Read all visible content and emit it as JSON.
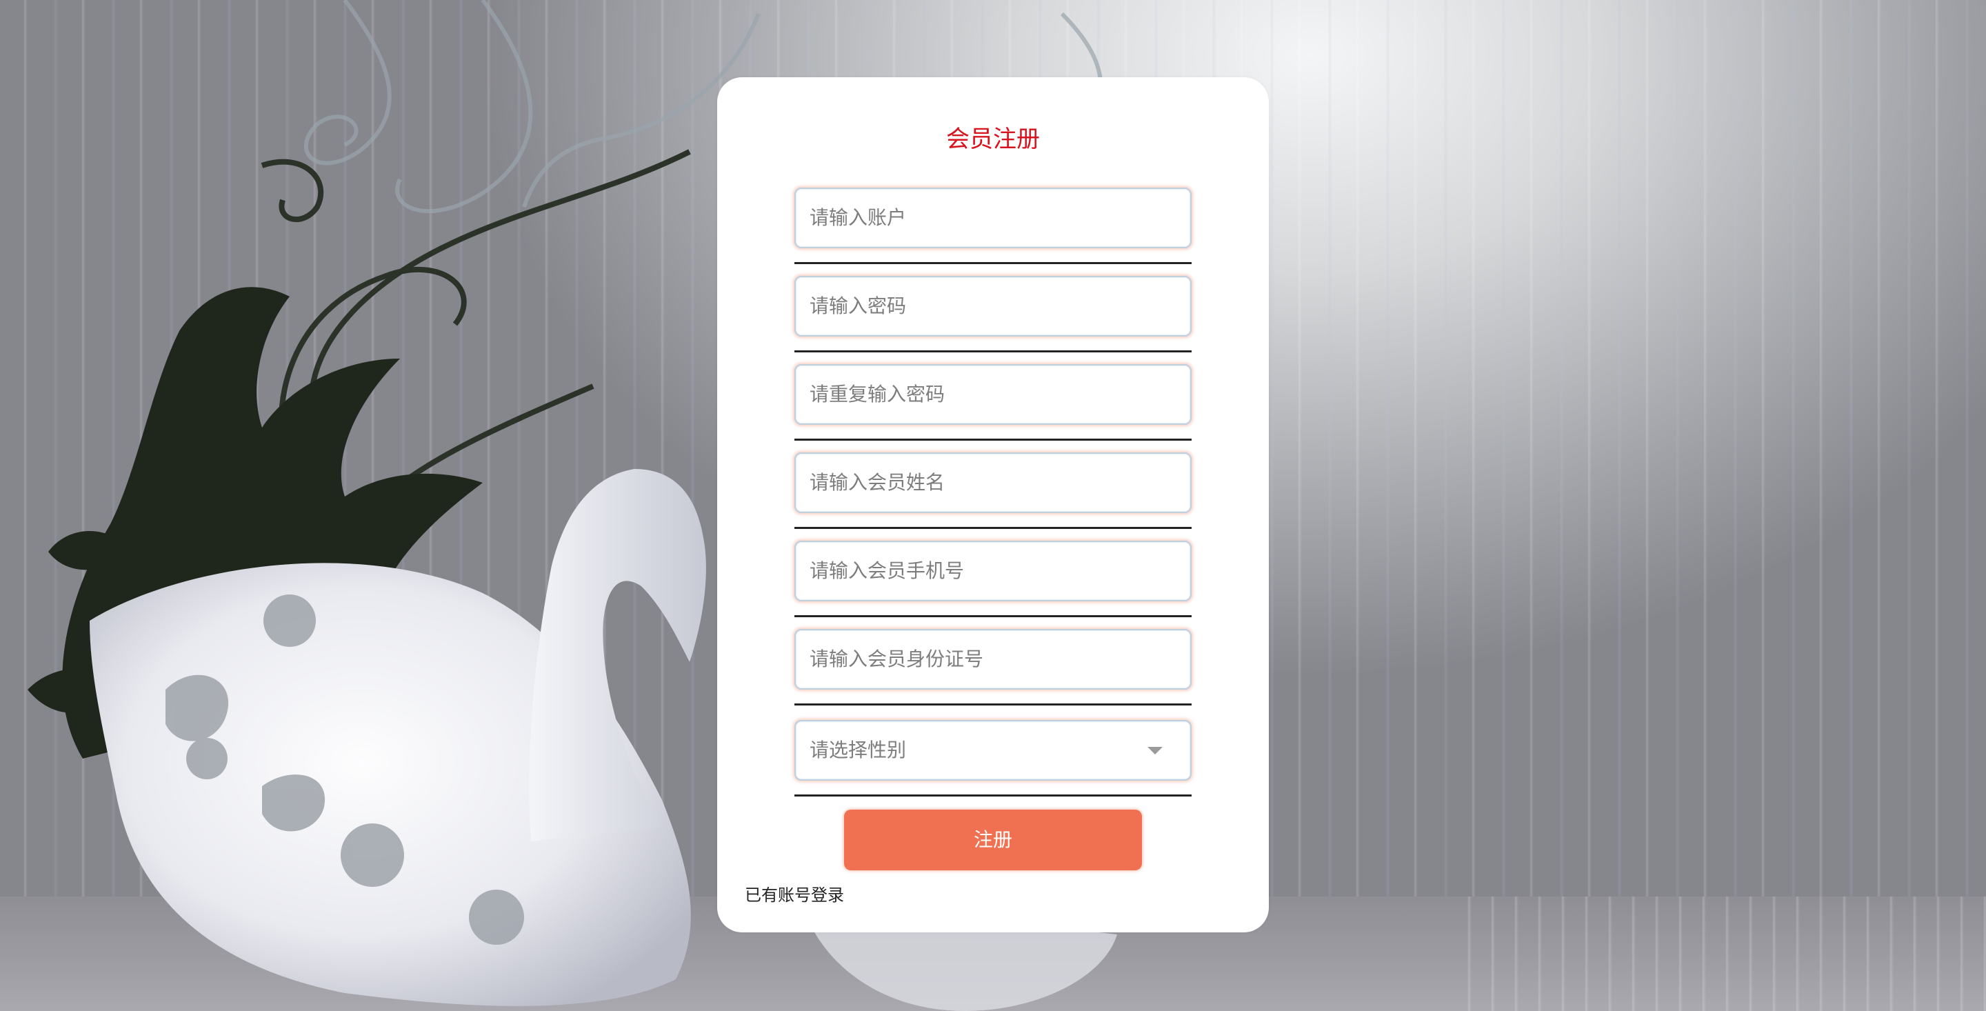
{
  "form": {
    "title": "会员注册",
    "fields": [
      {
        "placeholder": "请输入账户"
      },
      {
        "placeholder": "请输入密码"
      },
      {
        "placeholder": "请重复输入密码"
      },
      {
        "placeholder": "请输入会员姓名"
      },
      {
        "placeholder": "请输入会员手机号"
      },
      {
        "placeholder": "请输入会员身份证号"
      }
    ],
    "gender_select": {
      "placeholder": "请选择性别"
    },
    "submit_label": "注册",
    "login_link": "已有账号登录"
  },
  "colors": {
    "title": "#d9131d",
    "button": "#f07152",
    "card": "#ffffff"
  }
}
